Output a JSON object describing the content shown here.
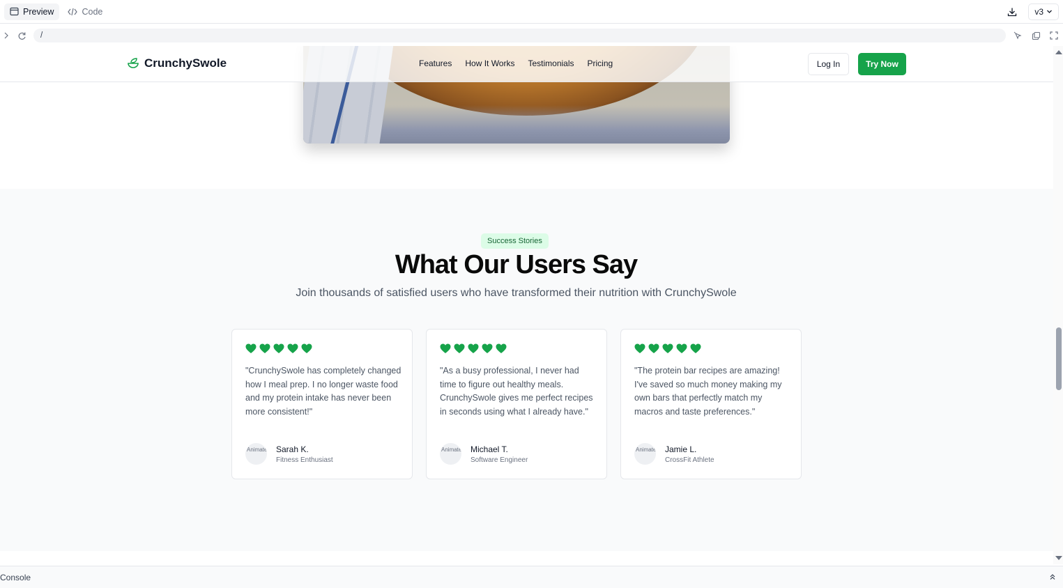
{
  "editor": {
    "tabs": [
      {
        "label": "Preview",
        "active": true
      },
      {
        "label": "Code",
        "active": false
      }
    ],
    "version": "v3",
    "url": "/"
  },
  "site": {
    "brand": "CrunchySwole",
    "nav": [
      "Features",
      "How It Works",
      "Testimonials",
      "Pricing"
    ],
    "login_label": "Log In",
    "cta_label": "Try Now",
    "accent_color": "#16a34a"
  },
  "testimonials": {
    "badge": "Success Stories",
    "title": "What Our Users Say",
    "subtitle": "Join thousands of satisfied users who have transformed their nutrition with CrunchySwole",
    "items": [
      {
        "rating": 5,
        "quote": "\"CrunchySwole has completely changed how I meal prep. I no longer waste food and my protein intake has never been more consistent!\"",
        "avatar_alt": "Animated avatar[]",
        "name": "Sarah K.",
        "role": "Fitness Enthusiast"
      },
      {
        "rating": 5,
        "quote": "\"As a busy professional, I never had time to figure out healthy meals. CrunchySwole gives me perfect recipes in seconds using what I already have.\"",
        "avatar_alt": "Animated boy]",
        "name": "Michael T.",
        "role": "Software Engineer"
      },
      {
        "rating": 5,
        "quote": "\"The protein bar recipes are amazing! I've saved so much money making my own bars that perfectly match my macros and taste preferences.\"",
        "avatar_alt": "Animated athlete",
        "name": "Jamie L.",
        "role": "CrossFit Athlete"
      }
    ]
  },
  "console": {
    "label": "Console"
  }
}
